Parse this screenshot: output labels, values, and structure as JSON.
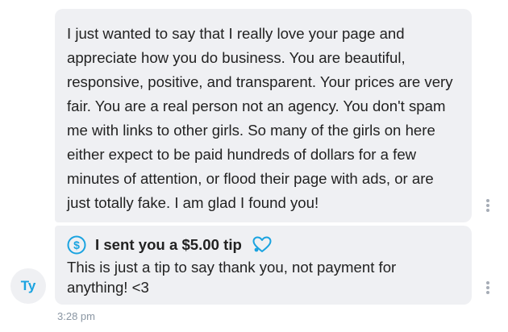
{
  "messages": [
    {
      "text": "I just wanted to say that I really love your page and appreciate how you do business. You are beautiful, responsive, positive, and transparent. Your prices are very fair. You are a real person not an agency. You don't spam me with links to other girls. So many of the girls on here either expect to be paid hundreds of dollars for a few minutes of attention, or flood their page with ads, or are just totally fake. I am glad I found you!"
    },
    {
      "tip_title": "I sent you a $5.00 tip",
      "tip_amount": 5.0,
      "tip_icon": "dollar-circle-icon",
      "reaction_icon": "heart-outline-icon",
      "text": "This is just a tip to say thank you, not payment for anything! <3"
    }
  ],
  "sender": {
    "initials": "Ty"
  },
  "timestamp": "3:28 pm",
  "more_icon": "vertical-dots-icon",
  "colors": {
    "bubble_bg": "#eff0f3",
    "accent": "#1aa3e0",
    "text": "#222222",
    "muted": "#8a96a3"
  }
}
